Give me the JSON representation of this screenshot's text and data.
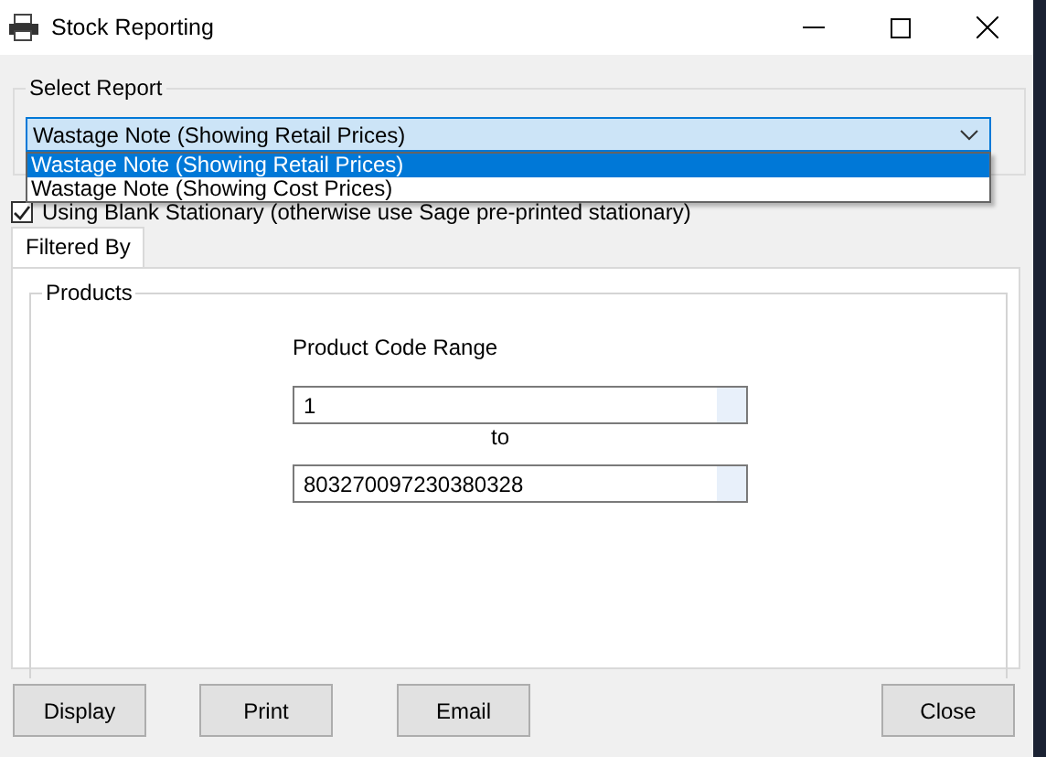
{
  "window": {
    "title": "Stock Reporting"
  },
  "report_group": {
    "title": "Select Report",
    "combo": {
      "value": "Wastage Note (Showing Retail Prices)",
      "expanded": true
    },
    "options": [
      {
        "label": "Wastage Note (Showing Retail Prices)",
        "selected": true
      },
      {
        "label": "Wastage Note (Showing Cost Prices)",
        "selected": false
      }
    ]
  },
  "blank_stationary": {
    "label": "Using Blank Stationary (otherwise use Sage pre-printed stationary)",
    "checked": true
  },
  "tabs": [
    {
      "label": "Filtered By",
      "selected": true
    }
  ],
  "products_group": {
    "title": "Products",
    "range_label": "Product Code Range",
    "from": "1",
    "separator": "to",
    "to": "803270097230380328"
  },
  "buttons": [
    "Display",
    "Print",
    "Email",
    "Close"
  ]
}
